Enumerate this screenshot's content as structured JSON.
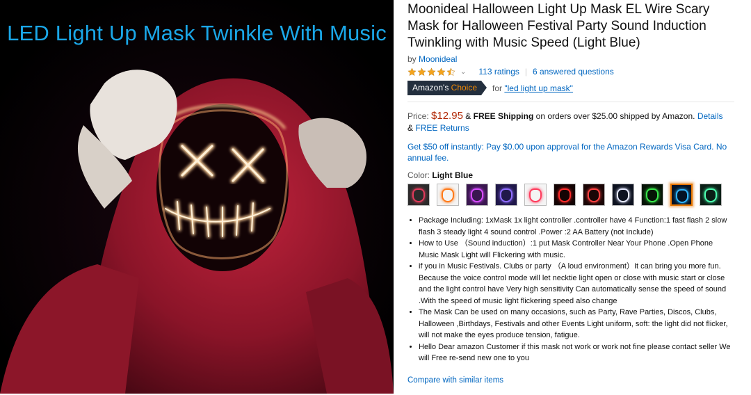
{
  "hero": {
    "caption": "LED Light Up Mask Twinkle With Music"
  },
  "product": {
    "title": "Moonideal Halloween Light Up Mask EL Wire Scary Mask for Halloween Festival Party Sound Induction Twinkling with Music Speed (Light Blue)",
    "by_label": "by",
    "brand": "Moonideal",
    "rating": 4.5,
    "ratings_text": "113 ratings",
    "questions_text": "6 answered questions",
    "choice_badge_prefix": "Amazon's",
    "choice_badge_word": "Choice",
    "choice_for_prefix": "for",
    "choice_for_query": "\"led light up mask\"",
    "price_label": "Price:",
    "price": "$12.95",
    "shipping_amp": "&",
    "shipping_bold": "FREE Shipping",
    "shipping_rest": "on orders over $25.00 shipped by Amazon.",
    "details_link": "Details",
    "returns_amp": "&",
    "returns_link": "FREE Returns",
    "promo": "Get $50 off instantly: Pay $0.00 upon approval for the Amazon Rewards Visa Card. No annual fee.",
    "color_label": "Color:",
    "color_value": "Light Blue",
    "bullets": [
      "Package Including: 1xMask 1x light controller .controller have 4 Function:1 fast flash 2 slow flash 3 steady light 4 sound control .Power :2 AA Battery (not Include)",
      "How to Use （Sound induction）:1 put Mask Controller Near Your Phone .Open Phone Music Mask Light will Flickering with music.",
      "if you in Music Festivals. Clubs or party （A loud environment）It can bring you more fun. Because the voice control mode will let necktie light open or close with music start or close and the light control have Very high sensitivity Can automatically sense the speed of sound .With the speed of music light flickering speed also change",
      "The Mask Can be used on many occasions, such as Party, Rave Parties, Discos, Clubs, Halloween ,Birthdays, Festivals and other Events Light uniform, soft: the light did not flicker, will not make the eyes produce tension, fatigue.",
      "Hello Dear amazon Customer if this mask not work or work not fine please contact seller We will Free re-send new one to you"
    ],
    "compare_link": "Compare with similar items"
  },
  "swatches": [
    {
      "name": "multicolor",
      "bg": "#2b2b2b",
      "glow": "#e03a5a"
    },
    {
      "name": "orange",
      "bg": "#f4f4f4",
      "glow": "#ff7a1a"
    },
    {
      "name": "purple",
      "bg": "#3a1750",
      "glow": "#d64cff"
    },
    {
      "name": "violet",
      "bg": "#20184a",
      "glow": "#8f6cff"
    },
    {
      "name": "pink",
      "bg": "#f4f4f4",
      "glow": "#ff3b5c"
    },
    {
      "name": "red",
      "bg": "#140404",
      "glow": "#ff2a2a"
    },
    {
      "name": "dark-red",
      "bg": "#1a0606",
      "glow": "#ff4040"
    },
    {
      "name": "white",
      "bg": "#0d1220",
      "glow": "#e6e9ff"
    },
    {
      "name": "green",
      "bg": "#061406",
      "glow": "#37e64a"
    },
    {
      "name": "light-blue",
      "bg": "#041325",
      "glow": "#2fb6ff",
      "selected": true
    },
    {
      "name": "mint",
      "bg": "#0a1f16",
      "glow": "#4dffb0"
    }
  ],
  "colors": {
    "link": "#0066c0",
    "price": "#b12704",
    "badge_bg": "#232f3e",
    "badge_accent": "#f08804",
    "star": "#f4a41d",
    "caption": "#1aa7e8"
  }
}
